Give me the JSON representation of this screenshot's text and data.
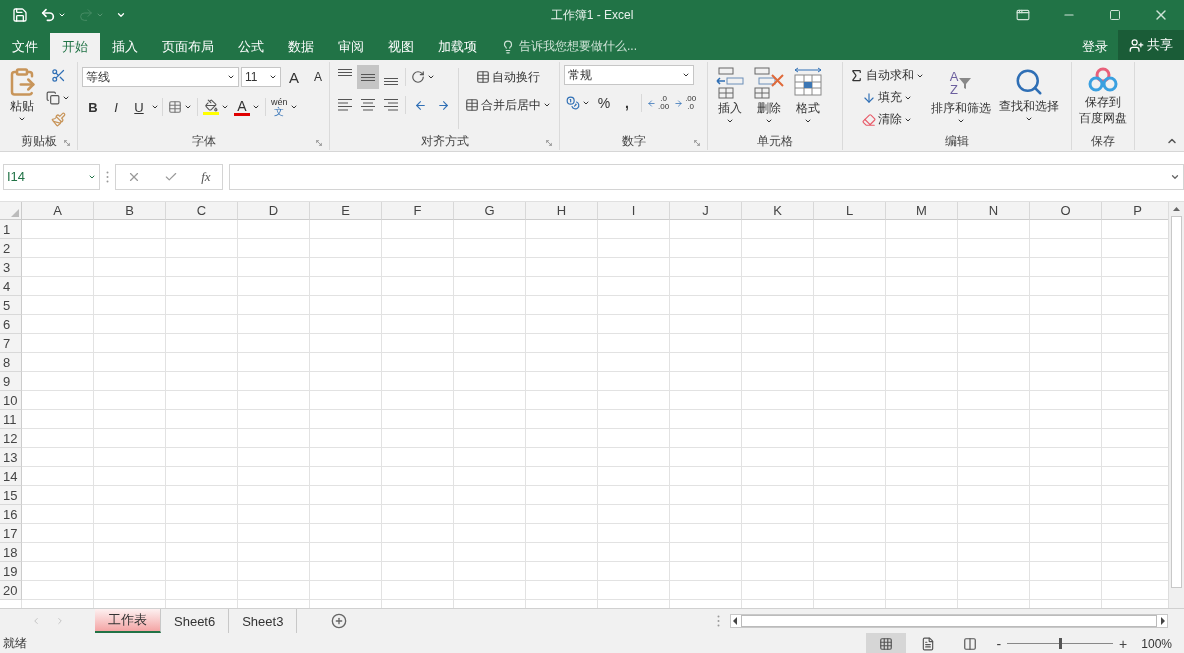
{
  "window": {
    "title": "工作簿1 - Excel"
  },
  "quick_access": [
    {
      "kind": "save",
      "disabled": false
    },
    {
      "kind": "undo",
      "disabled": false
    },
    {
      "kind": "redo",
      "disabled": true
    },
    {
      "kind": "customize",
      "disabled": false
    }
  ],
  "menu_tabs": [
    {
      "label": "文件",
      "selected": false
    },
    {
      "label": "开始",
      "selected": true
    },
    {
      "label": "插入",
      "selected": false
    },
    {
      "label": "页面布局",
      "selected": false
    },
    {
      "label": "公式",
      "selected": false
    },
    {
      "label": "数据",
      "selected": false
    },
    {
      "label": "审阅",
      "selected": false
    },
    {
      "label": "视图",
      "selected": false
    },
    {
      "label": "加载项",
      "selected": false
    }
  ],
  "tell_me": {
    "placeholder": "告诉我您想要做什么..."
  },
  "account": {
    "sign_in": "登录",
    "share": "共享"
  },
  "ribbon": {
    "clipboard": {
      "label": "剪贴板",
      "paste": "粘贴"
    },
    "font": {
      "label": "字体",
      "font_name": "等线",
      "font_size": "11",
      "grow": "A",
      "shrink": "A",
      "styles": [
        "B",
        "I",
        "U"
      ],
      "font_color": "A",
      "phonetic": "wén",
      "phonetic_char": "文"
    },
    "alignment": {
      "label": "对齐方式",
      "vertical_align": [
        {
          "selected": false
        },
        {
          "selected": true
        },
        {
          "selected": false
        }
      ],
      "wrap_text": "自动换行",
      "merge": "合并后居中"
    },
    "number": {
      "label": "数字",
      "format": "常规",
      "percent": "%",
      "comma": ",",
      "increase_decimal": [
        ".0",
        ".00"
      ],
      "decrease_decimal": [
        ".00",
        ".0"
      ]
    },
    "cells": {
      "label": "单元格",
      "buttons": [
        {
          "kind": "insert",
          "label": "插入"
        },
        {
          "kind": "delete",
          "label": "删除"
        },
        {
          "kind": "format",
          "label": "格式"
        }
      ]
    },
    "editing": {
      "label": "编辑",
      "autosum": "自动求和",
      "fill": "填充",
      "clear": "清除",
      "sort": "排序和筛选",
      "sort_letters": [
        "A",
        "Z"
      ],
      "find": "查找和选择"
    },
    "save": {
      "label": "保存",
      "button": [
        "保存到",
        "百度网盘"
      ]
    }
  },
  "formula_bar": {
    "name_box": "I14",
    "function_label": "fx"
  },
  "grid": {
    "columns": [
      "A",
      "B",
      "C",
      "D",
      "E",
      "F",
      "G",
      "H",
      "I",
      "J",
      "K",
      "L",
      "M",
      "N",
      "O",
      "P"
    ],
    "rows": [
      "1",
      "2",
      "3",
      "4",
      "5",
      "6",
      "7",
      "8",
      "9",
      "10",
      "11",
      "12",
      "13",
      "14",
      "15",
      "16",
      "17",
      "18",
      "19",
      "20"
    ]
  },
  "sheet_tabs": [
    {
      "label": "工作表",
      "selected": true
    },
    {
      "label": "Sheet6",
      "selected": false
    },
    {
      "label": "Sheet3",
      "selected": false
    }
  ],
  "status_bar": {
    "text": "就绪",
    "views": [
      {
        "kind": "normal",
        "selected": true
      },
      {
        "kind": "page_layout",
        "selected": false
      },
      {
        "kind": "page_break",
        "selected": false
      }
    ],
    "zoom_out": "-",
    "zoom_in": "+",
    "zoom": {
      "level": 0.5,
      "reading": "100%"
    }
  }
}
